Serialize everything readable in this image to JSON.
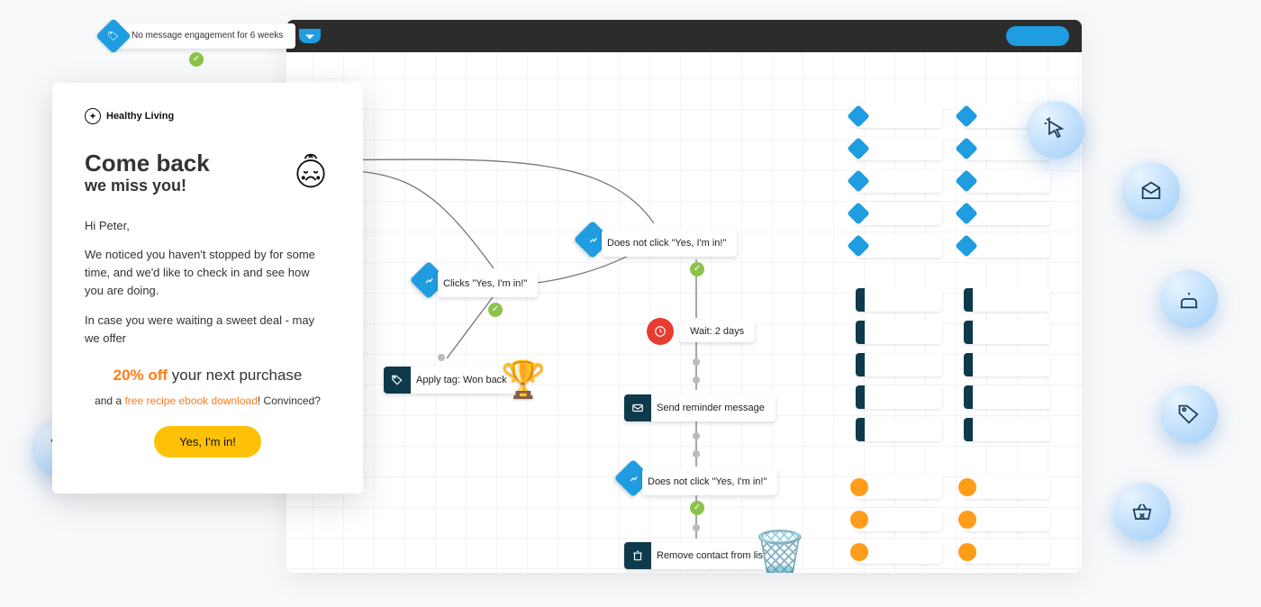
{
  "trigger": {
    "label": "No message engagement for 6 weeks"
  },
  "email": {
    "brand": "Healthy Living",
    "headline1": "Come back",
    "headline2": "we miss you!",
    "greeting": "Hi Peter,",
    "para1": "We noticed you haven't stopped by for some time, and we'd like to check in and see how you are doing.",
    "para2": "In case you were waiting a sweet deal - may we offer",
    "offer_pct": "20% off",
    "offer_rest": " your next purchase",
    "offer_sub_pre": "and a ",
    "offer_sub_link": "free recipe ebook download",
    "offer_sub_post": "! Convinced?",
    "cta": "Yes, I'm in!"
  },
  "flow": {
    "click_yes": "Clicks \"Yes, I'm in!\"",
    "not_click1": "Does not click \"Yes, I'm in!\"",
    "apply_tag": "Apply tag: Won back",
    "wait": "Wait: 2 days",
    "reminder": "Send reminder message",
    "not_click2": "Does not click \"Yes, I'm in!\"",
    "remove": "Remove contact from list"
  }
}
